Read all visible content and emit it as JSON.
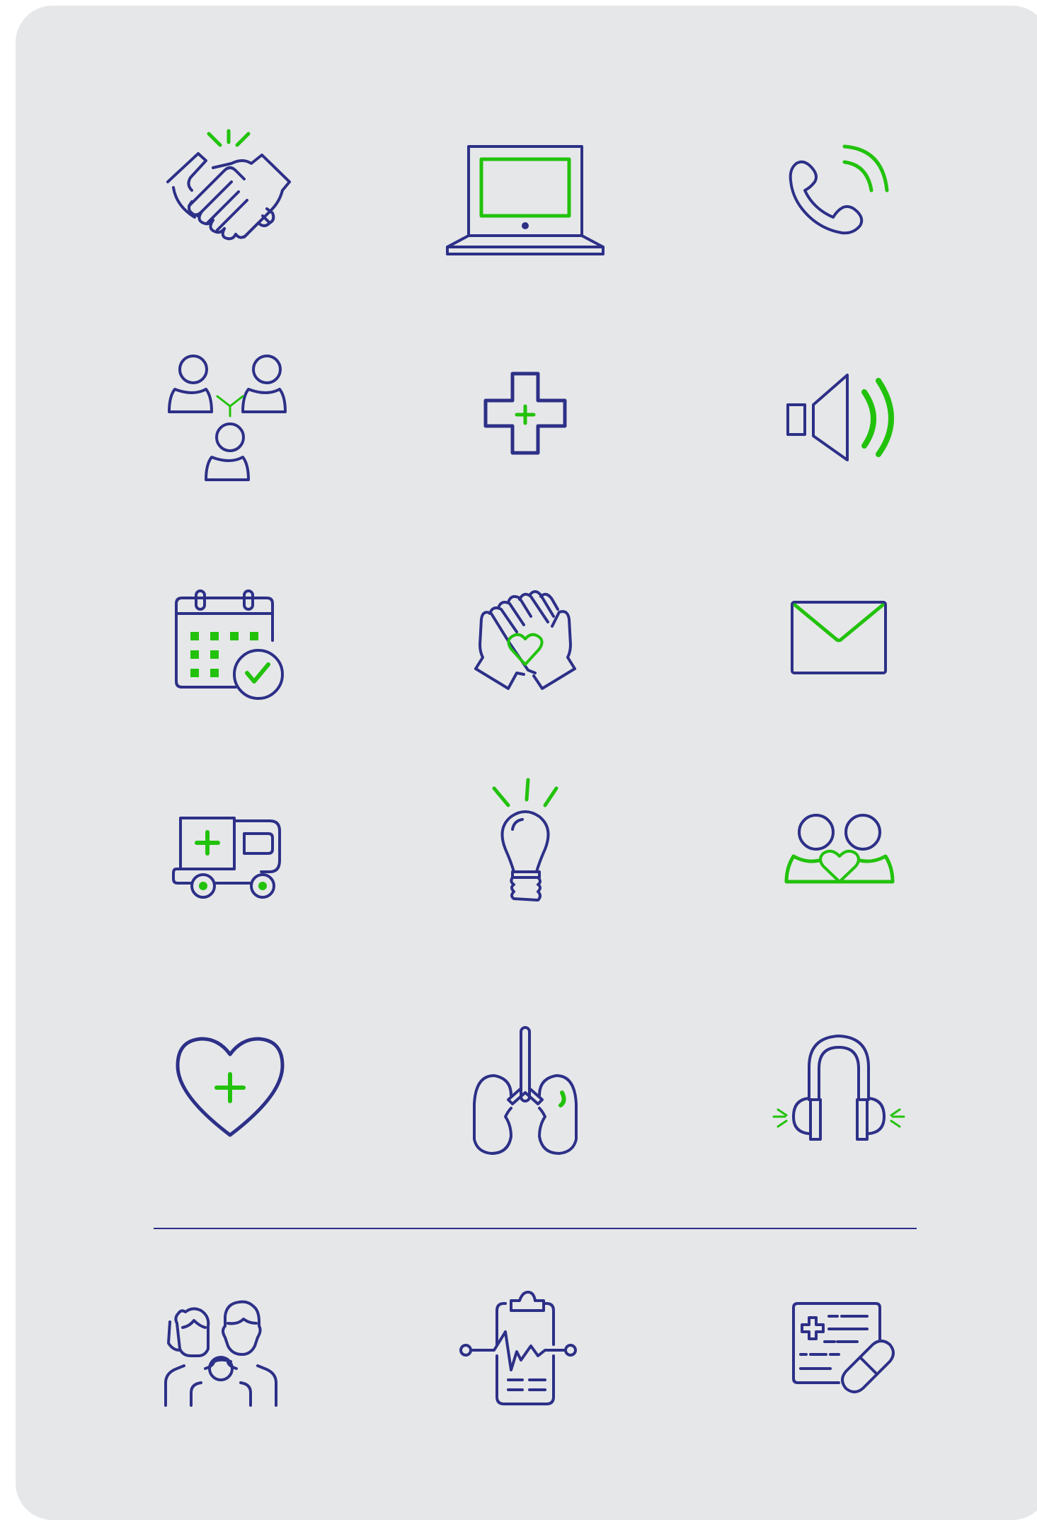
{
  "colors": {
    "background": "#e6e7e9",
    "primary": "#2d3087",
    "accent": "#22c20c"
  },
  "icons": [
    "handshake-icon",
    "laptop-icon",
    "phone-call-icon",
    "team-network-icon",
    "medical-cross-icon",
    "speaker-volume-icon",
    "calendar-check-icon",
    "caring-hands-heart-icon",
    "envelope-icon",
    "ambulance-icon",
    "lightbulb-idea-icon",
    "couple-love-icon",
    "heart-plus-icon",
    "lungs-icon",
    "headphones-icon",
    "family-icon",
    "clipboard-pulse-icon",
    "prescription-pill-icon"
  ]
}
